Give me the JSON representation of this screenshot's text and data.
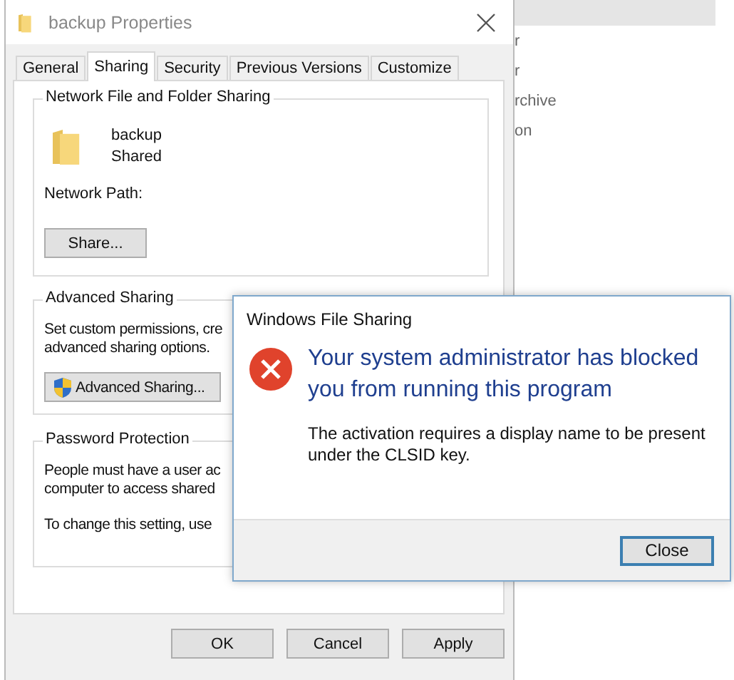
{
  "background_window": {
    "items": [
      "r",
      "r",
      "rchive",
      "on"
    ]
  },
  "properties": {
    "title": "backup Properties",
    "tabs": [
      {
        "label": "General",
        "selected": false
      },
      {
        "label": "Sharing",
        "selected": true
      },
      {
        "label": "Security",
        "selected": false
      },
      {
        "label": "Previous Versions",
        "selected": false
      },
      {
        "label": "Customize",
        "selected": false
      }
    ],
    "network_sharing": {
      "title": "Network File and Folder Sharing",
      "folder_name": "backup",
      "folder_status": "Shared",
      "network_path_label": "Network Path:",
      "share_button": "Share..."
    },
    "advanced_sharing": {
      "title": "Advanced Sharing",
      "description": [
        "Set custom permissions, cre",
        "advanced sharing options."
      ],
      "button": "Advanced Sharing..."
    },
    "password_protection": {
      "title": "Password Protection",
      "description": [
        "People must have a user ac",
        "computer to access shared"
      ],
      "note": "To change this setting, use"
    },
    "buttons": [
      "OK",
      "Cancel",
      "Apply"
    ]
  },
  "error_dialog": {
    "title": "Windows File Sharing",
    "heading": "Your system administrator has blocked you from running this program",
    "message": "The activation requires a display name to be present under the CLSID key.",
    "buttons": [
      {
        "label": "Close",
        "default": true
      }
    ]
  }
}
